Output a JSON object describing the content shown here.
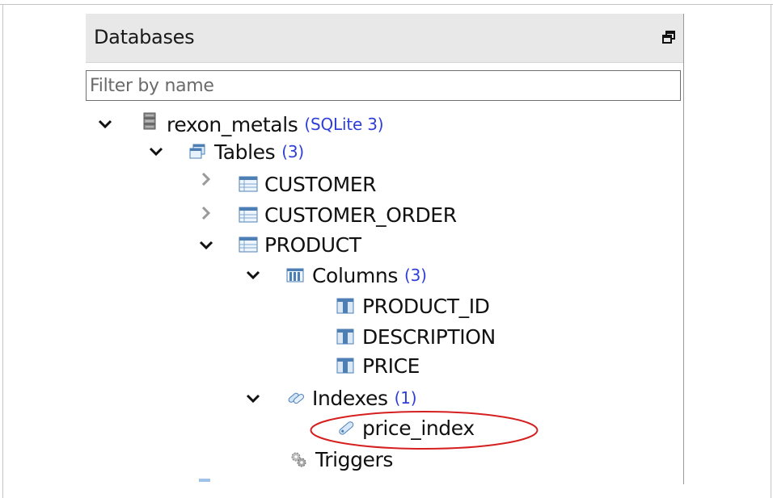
{
  "panel": {
    "title": "Databases",
    "float_icon": "restore-window-icon"
  },
  "filter": {
    "placeholder": "Filter by name",
    "value": ""
  },
  "tree": {
    "database": {
      "label": "rexon_metals",
      "engine": "(SQLite 3)",
      "icon": "database-icon",
      "expanded": true
    },
    "tables": {
      "label": "Tables",
      "count": "(3)",
      "icon": "tables-group-icon",
      "expanded": true
    },
    "table_items": [
      {
        "label": "CUSTOMER",
        "icon": "table-icon",
        "expanded": false
      },
      {
        "label": "CUSTOMER_ORDER",
        "icon": "table-icon",
        "expanded": false
      },
      {
        "label": "PRODUCT",
        "icon": "table-icon",
        "expanded": true
      }
    ],
    "columns": {
      "label": "Columns",
      "count": "(3)",
      "icon": "columns-group-icon",
      "expanded": true
    },
    "column_items": [
      {
        "label": "PRODUCT_ID",
        "icon": "column-icon"
      },
      {
        "label": "DESCRIPTION",
        "icon": "column-icon"
      },
      {
        "label": "PRICE",
        "icon": "column-icon"
      }
    ],
    "indexes": {
      "label": "Indexes",
      "count": "(1)",
      "icon": "index-group-icon",
      "expanded": true
    },
    "index_items": [
      {
        "label": "price_index",
        "icon": "index-icon",
        "highlighted": true
      }
    ],
    "triggers": {
      "label": "Triggers",
      "icon": "triggers-icon"
    }
  },
  "colors": {
    "count_text": "#2f3fd6",
    "highlight_ring": "#d62020",
    "header_bg": "#e8e8e8"
  }
}
